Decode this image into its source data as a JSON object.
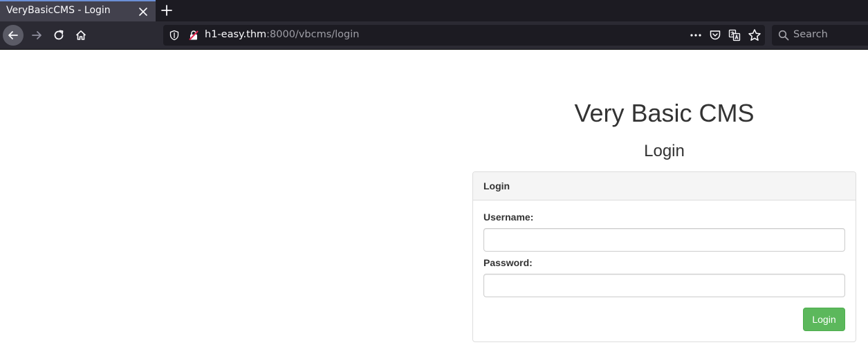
{
  "browser": {
    "tab_title": "VeryBasicCMS - Login",
    "url_host": "h1-easy.thm",
    "url_rest": ":8000/vbcms/login",
    "search_placeholder": "Search",
    "icons": [
      "back-arrow-icon",
      "forward-arrow-icon",
      "reload-icon",
      "home-icon",
      "shield-icon",
      "insecure-lock-icon",
      "more-icon",
      "pocket-icon",
      "translate-icon",
      "bookmark-star-icon",
      "search-icon",
      "close-icon",
      "plus-icon"
    ]
  },
  "page": {
    "title": "Very Basic CMS",
    "subtitle": "Login",
    "panel": {
      "heading": "Login",
      "username_label": "Username:",
      "username_value": "",
      "password_label": "Password:",
      "password_value": "",
      "submit_label": "Login"
    }
  },
  "colors": {
    "submit_button": "#5cb85c",
    "tab_accent": "#6b8fd6"
  }
}
